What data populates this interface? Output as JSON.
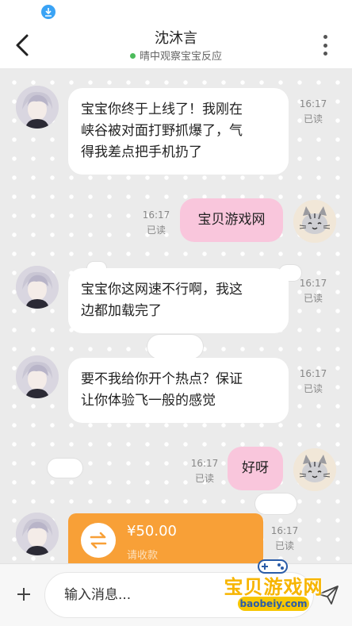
{
  "header": {
    "title": "沈沐言",
    "subtitle": "晴中观察宝宝反应"
  },
  "messages": [
    {
      "side": "left",
      "text_lines": [
        "宝宝你终于上线了！我刚在",
        "峡谷被对面打野抓爆了，气",
        "得我差点把手机扔了"
      ],
      "time": "16:17",
      "status": "已读"
    },
    {
      "side": "right",
      "text": "宝贝游戏网",
      "time": "16:17",
      "status": "已读"
    },
    {
      "side": "left",
      "text_lines": [
        "宝宝你这网速不行啊，我这",
        "边都加载完了"
      ],
      "time": "16:17",
      "status": "已读"
    },
    {
      "side": "left",
      "text_lines": [
        "要不我给你开个热点？保证",
        "让你体验飞一般的感觉"
      ],
      "time": "16:17",
      "status": "已读"
    },
    {
      "side": "right",
      "text": "好呀",
      "time": "16:17",
      "status": "已读"
    }
  ],
  "transfer": {
    "amount": "¥50.00",
    "label": "请收款",
    "time": "16:17",
    "status": "已读"
  },
  "input": {
    "placeholder": "输入消息..."
  },
  "watermark": {
    "text": "宝贝游戏网",
    "url": "baobeiy.com"
  },
  "colors": {
    "bubble_right": "#f9c6dc",
    "transfer": "#f8a037",
    "online": "#4cbb5b"
  }
}
